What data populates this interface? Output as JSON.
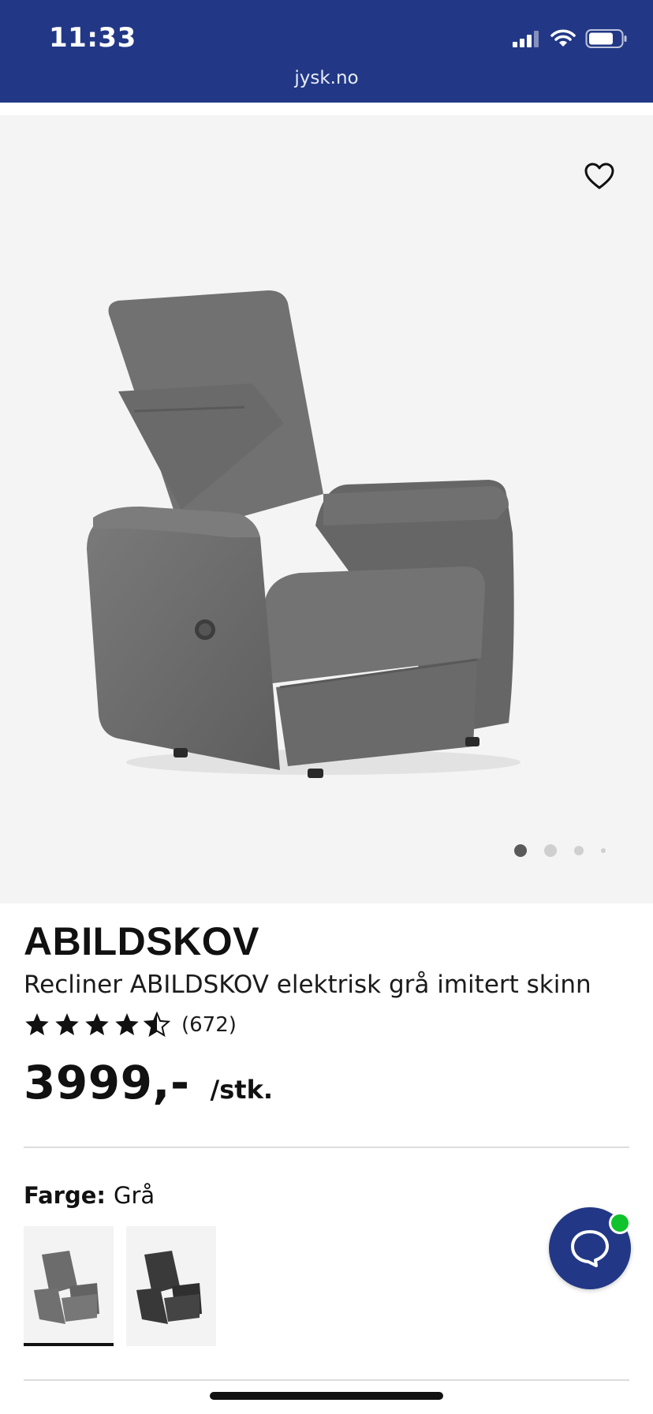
{
  "status_bar": {
    "time": "11:33"
  },
  "browser": {
    "url": "jysk.no"
  },
  "gallery": {
    "slide_count": 4,
    "active_slide": 1
  },
  "product": {
    "brand": "ABILDSKOV",
    "name": "Recliner ABILDSKOV elektrisk grå imitert skinn",
    "rating": 4.5,
    "reviews": "(672)",
    "price": "3999,-",
    "unit": "/stk.",
    "color_label": "Farge:",
    "color_value": "Grå",
    "swatches": [
      {
        "color": "#6b6b6b",
        "selected": true
      },
      {
        "color": "#3a3a3a",
        "selected": false
      }
    ]
  },
  "colors": {
    "brand_blue": "#223886",
    "online_green": "#10c22b",
    "chair_gray": "#6e6e6e"
  },
  "icons": {
    "favorite": "heart-outline-icon",
    "chat": "chat-bubble-icon"
  }
}
